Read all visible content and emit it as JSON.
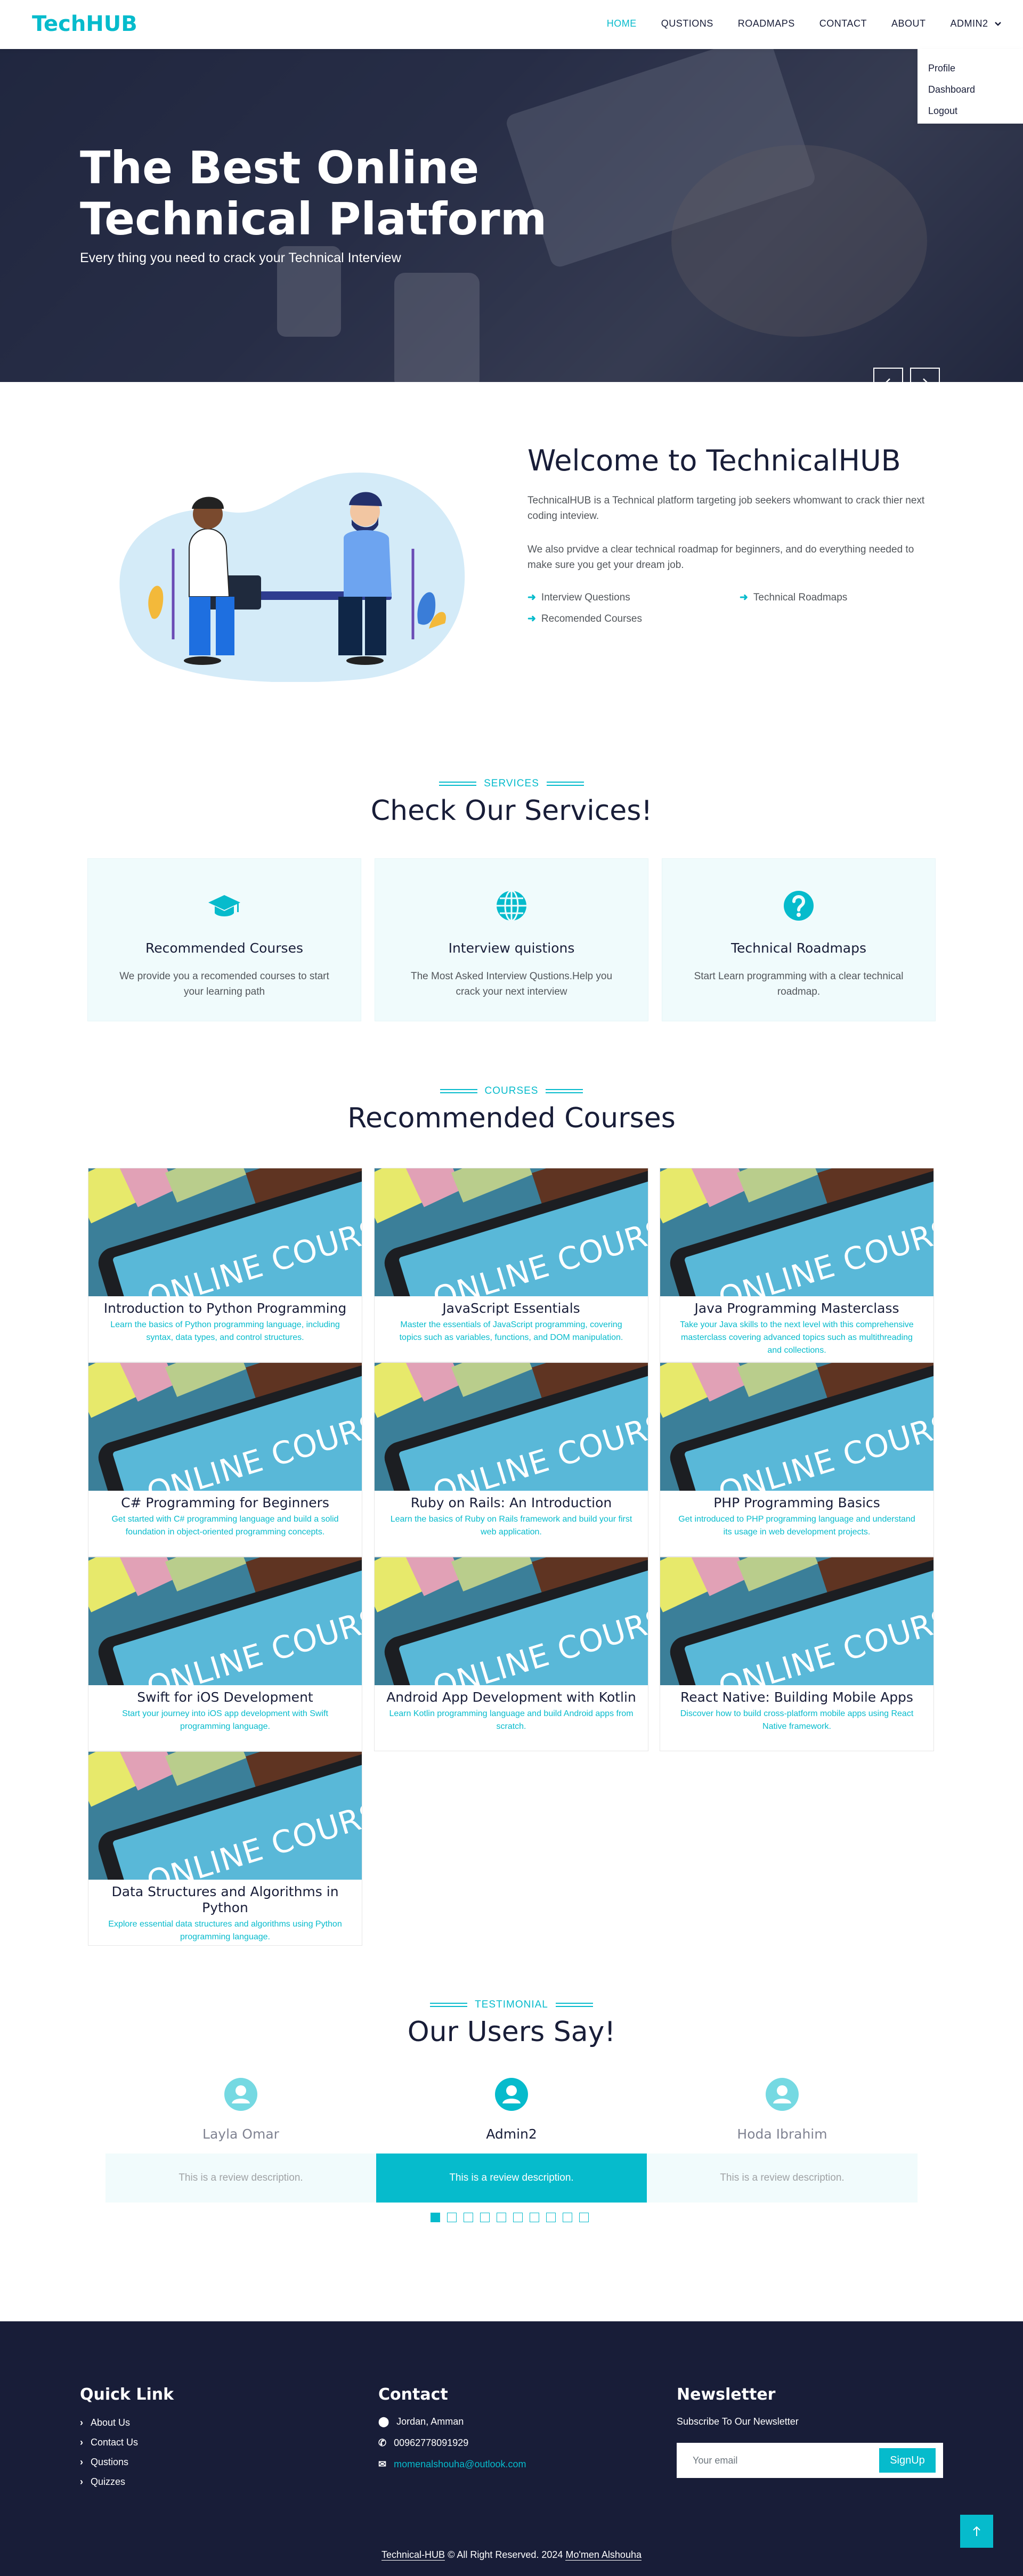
{
  "nav": {
    "brand": "TechHUB",
    "links": [
      "HOME",
      "QUSTIONS",
      "ROADMAPS",
      "CONTACT",
      "ABOUT",
      "ADMIN2"
    ],
    "dropdown": [
      "Profile",
      "Dashboard",
      "Logout"
    ]
  },
  "hero": {
    "title": "The Best Online Technical Platform",
    "subtitle": "Every thing you need to crack your Technical Interview",
    "prev_icon": "chevron-left-icon",
    "next_icon": "chevron-right-icon"
  },
  "welcome": {
    "title": "Welcome to TechnicalHUB",
    "p1": "TechnicalHUB is a Technical platform targeting job seekers whomwant to crack thier next coding inteview.",
    "p2": "We also prvidve a clear technical roadmap for beginners, and do everything needed to make sure you get your dream job.",
    "features": [
      "Interview Questions",
      "Technical Roadmaps",
      "Recomended Courses"
    ]
  },
  "services": {
    "tag": "SERVICES",
    "title": "Check Our Services!",
    "items": [
      {
        "icon": "graduation-cap-icon",
        "title": "Recommended Courses",
        "desc": "We provide you a recomended courses to start your learning path"
      },
      {
        "icon": "globe-icon",
        "title": "Interview quistions",
        "desc": "The Most Asked Interview Qustions.Help you crack your next interview"
      },
      {
        "icon": "question-circle-icon",
        "title": "Technical Roadmaps",
        "desc": "Start Learn programming with a clear technical roadmap."
      }
    ]
  },
  "courses": {
    "tag": "COURSES",
    "title": "Recommended Courses",
    "thumb_text": "ONLINE COURSES",
    "items": [
      {
        "title": "Introduction to Python Programming",
        "desc": "Learn the basics of Python programming language, including syntax, data types, and control structures."
      },
      {
        "title": "JavaScript Essentials",
        "desc": "Master the essentials of JavaScript programming, covering topics such as variables, functions, and DOM manipulation."
      },
      {
        "title": "Java Programming Masterclass",
        "desc": "Take your Java skills to the next level with this comprehensive masterclass covering advanced topics such as multithreading and collections."
      },
      {
        "title": "C# Programming for Beginners",
        "desc": "Get started with C# programming language and build a solid foundation in object-oriented programming concepts."
      },
      {
        "title": "Ruby on Rails: An Introduction",
        "desc": "Learn the basics of Ruby on Rails framework and build your first web application."
      },
      {
        "title": "PHP Programming Basics",
        "desc": "Get introduced to PHP programming language and understand its usage in web development projects."
      },
      {
        "title": "Swift for iOS Development",
        "desc": "Start your journey into iOS app development with Swift programming language."
      },
      {
        "title": "Android App Development with Kotlin",
        "desc": "Learn Kotlin programming language and build Android apps from scratch."
      },
      {
        "title": "React Native: Building Mobile Apps",
        "desc": "Discover how to build cross-platform mobile apps using React Native framework."
      },
      {
        "title": "Data Structures and Algorithms in Python",
        "desc": "Explore essential data structures and algorithms using Python programming language."
      }
    ]
  },
  "testimonials": {
    "tag": "TESTIMONIAL",
    "title": "Our Users Say!",
    "items": [
      {
        "name": "Layla Omar",
        "review": "This is a review description."
      },
      {
        "name": "Admin2",
        "review": "This is a review description."
      },
      {
        "name": "Hoda Ibrahim",
        "review": "This is a review description."
      }
    ],
    "active_dot": 1,
    "dot_count": 10
  },
  "footer": {
    "quick_title": "Quick Link",
    "quick_links": [
      "About Us",
      "Contact Us",
      "Qustions",
      "Quizzes"
    ],
    "contact_title": "Contact",
    "address": "Jordan, Amman",
    "phone": "00962778091929",
    "email": "momenalshouha@outlook.com",
    "news_title": "Newsletter",
    "news_sub": "Subscribe To Our Newsletter",
    "news_placeholder": "Your email",
    "news_button": "SignUp",
    "copy_brand": "Technical-HUB",
    "copy_text": " © All Right Reserved. 2024 ",
    "copy_author": "Mo'men Alshouha"
  },
  "colors": {
    "accent": "#06bbcc",
    "dark": "#181d38"
  }
}
